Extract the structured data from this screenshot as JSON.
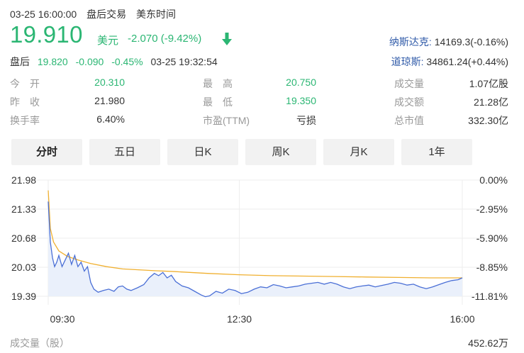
{
  "header": {
    "datetime": "03-25 16:00:00",
    "session": "盘后交易",
    "timezone": "美东时间"
  },
  "price": {
    "value": "19.910",
    "currency": "美元",
    "change": "-2.070 (-9.42%)",
    "trend_icon": "arrow-down-icon",
    "color": "#2bb673"
  },
  "after_hours": {
    "label": "盘后",
    "price": "19.820",
    "change": "-0.090",
    "percent": "-0.45%",
    "time": "03-25 19:32:54"
  },
  "indices": [
    {
      "name": "纳斯达克",
      "value": "14169.3(-0.16%)"
    },
    {
      "name": "道琼斯",
      "value": "34861.24(+0.44%)"
    }
  ],
  "quote": [
    [
      {
        "label": "今　开",
        "value": "20.310",
        "color": "#2bb673"
      },
      {
        "label": "最　高",
        "value": "20.750",
        "color": "#2bb673"
      },
      {
        "label": "成交量",
        "value": "1.07亿股",
        "color": "#333333"
      }
    ],
    [
      {
        "label": "昨　收",
        "value": "21.980",
        "color": "#333333"
      },
      {
        "label": "最　低",
        "value": "19.350",
        "color": "#2bb673"
      },
      {
        "label": "成交额",
        "value": "21.28亿",
        "color": "#333333"
      }
    ],
    [
      {
        "label": "换手率",
        "value": "6.40%",
        "color": "#333333"
      },
      {
        "label": "市盈(TTM)",
        "value": "亏损",
        "color": "#333333"
      },
      {
        "label": "总市值",
        "value": "332.30亿",
        "color": "#333333"
      }
    ]
  ],
  "tabs": [
    {
      "label": "分时",
      "active": true
    },
    {
      "label": "五日",
      "active": false
    },
    {
      "label": "日K",
      "active": false
    },
    {
      "label": "周K",
      "active": false
    },
    {
      "label": "月K",
      "active": false
    },
    {
      "label": "1年",
      "active": false
    }
  ],
  "chart_data": {
    "type": "line",
    "y_left_ticks": [
      "21.98",
      "21.33",
      "20.68",
      "20.03",
      "19.39"
    ],
    "y_right_ticks": [
      "0.00%",
      "-2.95%",
      "-5.90%",
      "-8.85%",
      "-11.81%"
    ],
    "x_ticks": [
      "09:30",
      "12:30",
      "16:00"
    ],
    "ylim": [
      19.39,
      21.98
    ],
    "xlim": [
      0,
      390
    ],
    "grid": true,
    "colors": {
      "price": "#4a6fd6",
      "average": "#f0b030",
      "fill": "#e8eefb"
    },
    "series": [
      {
        "key": "price",
        "values": [
          [
            0,
            21.5
          ],
          [
            2,
            20.6
          ],
          [
            4,
            20.25
          ],
          [
            6,
            20.05
          ],
          [
            8,
            20.15
          ],
          [
            10,
            20.3
          ],
          [
            13,
            20.05
          ],
          [
            16,
            20.2
          ],
          [
            19,
            20.35
          ],
          [
            22,
            20.1
          ],
          [
            25,
            20.3
          ],
          [
            28,
            20.05
          ],
          [
            31,
            20.15
          ],
          [
            34,
            19.95
          ],
          [
            37,
            20.05
          ],
          [
            40,
            19.7
          ],
          [
            43,
            19.55
          ],
          [
            47,
            19.48
          ],
          [
            52,
            19.52
          ],
          [
            57,
            19.55
          ],
          [
            62,
            19.5
          ],
          [
            66,
            19.6
          ],
          [
            70,
            19.62
          ],
          [
            74,
            19.55
          ],
          [
            78,
            19.52
          ],
          [
            84,
            19.58
          ],
          [
            90,
            19.65
          ],
          [
            95,
            19.8
          ],
          [
            100,
            19.9
          ],
          [
            104,
            19.85
          ],
          [
            108,
            19.92
          ],
          [
            112,
            19.8
          ],
          [
            116,
            19.86
          ],
          [
            120,
            19.72
          ],
          [
            126,
            19.62
          ],
          [
            132,
            19.58
          ],
          [
            138,
            19.5
          ],
          [
            144,
            19.42
          ],
          [
            148,
            19.38
          ],
          [
            152,
            19.4
          ],
          [
            158,
            19.5
          ],
          [
            164,
            19.46
          ],
          [
            170,
            19.55
          ],
          [
            176,
            19.52
          ],
          [
            182,
            19.45
          ],
          [
            188,
            19.48
          ],
          [
            194,
            19.55
          ],
          [
            200,
            19.6
          ],
          [
            206,
            19.58
          ],
          [
            212,
            19.65
          ],
          [
            218,
            19.62
          ],
          [
            224,
            19.58
          ],
          [
            230,
            19.6
          ],
          [
            236,
            19.62
          ],
          [
            242,
            19.66
          ],
          [
            248,
            19.68
          ],
          [
            254,
            19.7
          ],
          [
            260,
            19.66
          ],
          [
            266,
            19.7
          ],
          [
            272,
            19.66
          ],
          [
            278,
            19.6
          ],
          [
            284,
            19.56
          ],
          [
            290,
            19.6
          ],
          [
            296,
            19.62
          ],
          [
            302,
            19.64
          ],
          [
            308,
            19.6
          ],
          [
            314,
            19.63
          ],
          [
            320,
            19.66
          ],
          [
            326,
            19.7
          ],
          [
            332,
            19.68
          ],
          [
            338,
            19.64
          ],
          [
            344,
            19.66
          ],
          [
            350,
            19.6
          ],
          [
            356,
            19.56
          ],
          [
            362,
            19.6
          ],
          [
            368,
            19.65
          ],
          [
            374,
            19.7
          ],
          [
            380,
            19.74
          ],
          [
            386,
            19.76
          ],
          [
            390,
            19.8
          ]
        ]
      },
      {
        "key": "average",
        "values": [
          [
            0,
            21.75
          ],
          [
            2,
            20.9
          ],
          [
            5,
            20.6
          ],
          [
            10,
            20.4
          ],
          [
            18,
            20.28
          ],
          [
            28,
            20.2
          ],
          [
            40,
            20.12
          ],
          [
            55,
            20.05
          ],
          [
            70,
            20.0
          ],
          [
            85,
            19.98
          ],
          [
            100,
            19.96
          ],
          [
            120,
            19.94
          ],
          [
            150,
            19.9
          ],
          [
            180,
            19.87
          ],
          [
            210,
            19.85
          ],
          [
            240,
            19.84
          ],
          [
            270,
            19.83
          ],
          [
            300,
            19.82
          ],
          [
            330,
            19.81
          ],
          [
            360,
            19.8
          ],
          [
            390,
            19.8
          ]
        ]
      }
    ]
  },
  "volume": {
    "label": "成交量（股）",
    "value": "452.62万"
  }
}
